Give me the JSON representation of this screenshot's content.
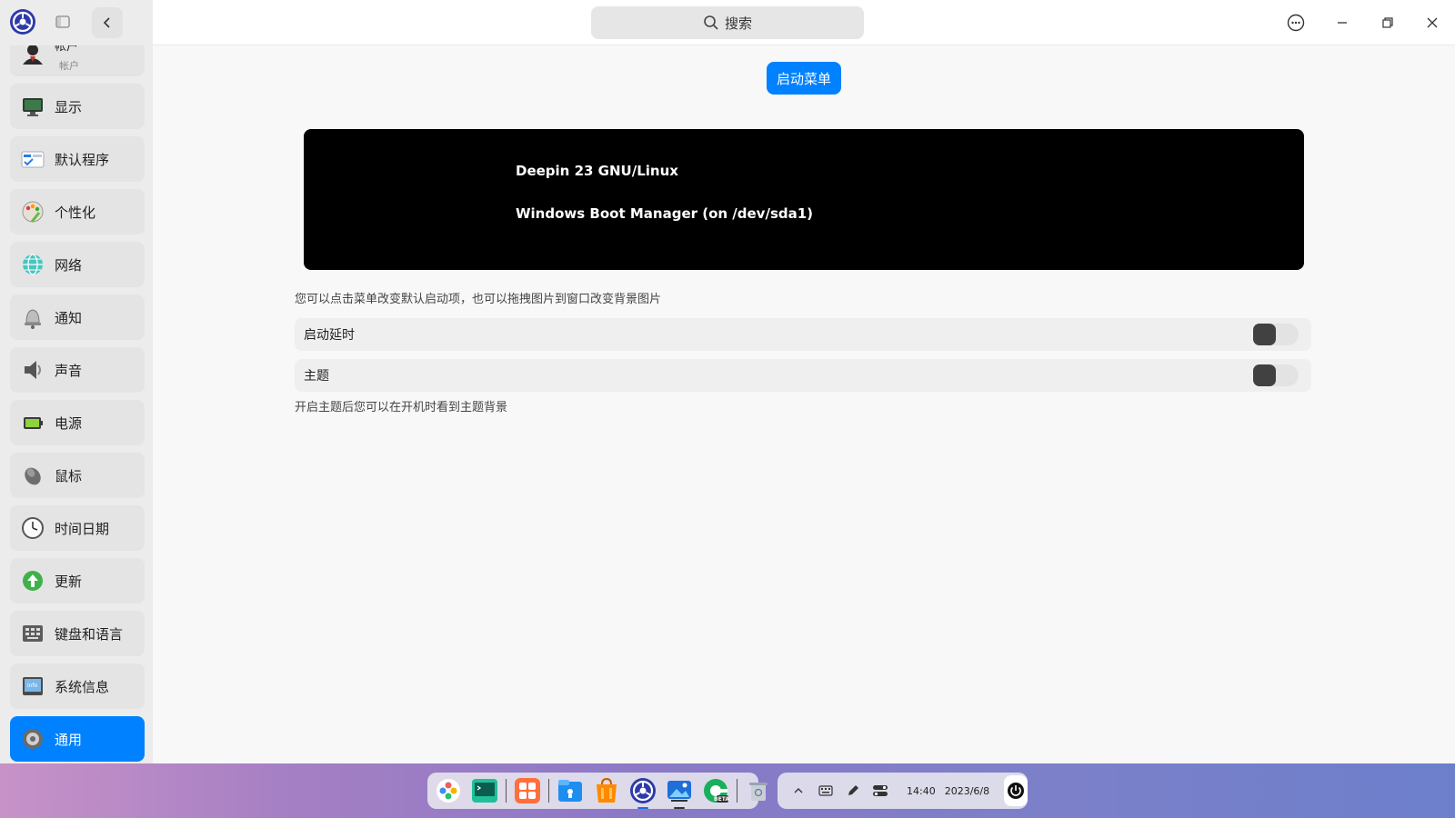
{
  "window": {
    "search_placeholder": "搜索",
    "controls": {
      "menu": "more-icon",
      "minimize": "minimize-icon",
      "maximize": "restore-icon",
      "close": "close-icon"
    }
  },
  "sidebar": {
    "items": [
      {
        "label": "帐户",
        "sub": "帐户",
        "icon": "account-icon"
      },
      {
        "label": "显示",
        "icon": "display-icon"
      },
      {
        "label": "默认程序",
        "icon": "default-apps-icon"
      },
      {
        "label": "个性化",
        "icon": "personalization-icon"
      },
      {
        "label": "网络",
        "icon": "network-icon"
      },
      {
        "label": "通知",
        "icon": "notification-icon"
      },
      {
        "label": "声音",
        "icon": "sound-icon"
      },
      {
        "label": "电源",
        "icon": "power-icon"
      },
      {
        "label": "鼠标",
        "icon": "mouse-icon"
      },
      {
        "label": "时间日期",
        "icon": "clock-icon"
      },
      {
        "label": "更新",
        "icon": "update-icon"
      },
      {
        "label": "键盘和语言",
        "icon": "keyboard-icon"
      },
      {
        "label": "系统信息",
        "icon": "system-info-icon"
      },
      {
        "label": "通用",
        "icon": "general-icon",
        "active": true
      }
    ]
  },
  "main": {
    "boot_menu_button": "启动菜单",
    "boot_entries": [
      "Deepin 23 GNU/Linux",
      "Windows Boot Manager (on /dev/sda1)"
    ],
    "hint": "您可以点击菜单改变默认启动项，也可以拖拽图片到窗口改变背景图片",
    "settings": [
      {
        "label": "启动延时",
        "enabled": false
      },
      {
        "label": "主题",
        "enabled": false
      }
    ],
    "theme_hint": "开启主题后您可以在开机时看到主题背景"
  },
  "dock": {
    "apps": [
      "launcher-icon",
      "terminal-icon",
      "app-store-icon",
      "file-manager-icon",
      "deepin-store-icon",
      "control-center-icon",
      "image-viewer-icon",
      "browser-icon",
      "trash-icon"
    ],
    "beta_badge": "BETA",
    "tray": {
      "time": "14:40",
      "date": "2023/6/8"
    }
  },
  "colors": {
    "accent": "#0081ff",
    "boot_bg": "#000000",
    "toggle_knob": "#414141"
  }
}
